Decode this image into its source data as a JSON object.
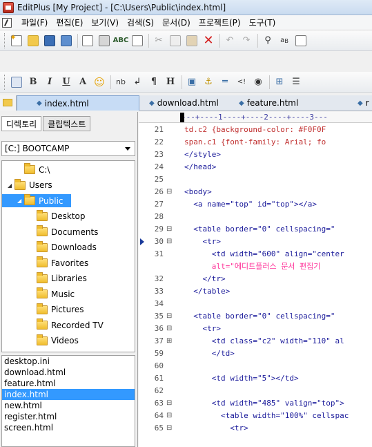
{
  "window": {
    "title": "EditPlus [My Project] - [C:\\Users\\Public\\index.html]"
  },
  "menu": [
    "파일(F)",
    "편집(E)",
    "보기(V)",
    "검색(S)",
    "문서(D)",
    "프로젝트(P)",
    "도구(T)"
  ],
  "toolbar1": [
    "new-file-icon",
    "open-icon",
    "save-icon",
    "save-all-icon",
    "print-preview-icon",
    "print-icon",
    "spellcheck-icon",
    "page-icon",
    "cut-icon",
    "copy-icon",
    "paste-icon",
    "delete-icon",
    "undo-icon",
    "redo-icon",
    "find-icon",
    "replace-icon",
    "copy-doc-icon"
  ],
  "toolbar2": {
    "buttons": [
      {
        "name": "html-preview-icon",
        "label": ""
      },
      {
        "name": "bold-button",
        "label": "B"
      },
      {
        "name": "italic-button",
        "label": "I"
      },
      {
        "name": "underline-button",
        "label": "U"
      },
      {
        "name": "font-button",
        "label": "A"
      },
      {
        "name": "color-button",
        "label": "☺"
      },
      {
        "name": "nbsp-button",
        "label": "nb"
      },
      {
        "name": "break-button",
        "label": "↲"
      },
      {
        "name": "paragraph-button",
        "label": "¶"
      },
      {
        "name": "heading-button",
        "label": "H"
      },
      {
        "name": "image-button",
        "label": "▣"
      },
      {
        "name": "anchor-button",
        "label": "⚓"
      },
      {
        "name": "hr-button",
        "label": "═"
      },
      {
        "name": "comment-button",
        "label": "<!"
      },
      {
        "name": "center-button",
        "label": "◉"
      },
      {
        "name": "table-button",
        "label": "⊞"
      },
      {
        "name": "list-button",
        "label": "☰"
      }
    ]
  },
  "tabs": [
    "index.html",
    "download.html",
    "feature.html",
    "r"
  ],
  "left": {
    "subtabs": [
      "디렉토리",
      "클립텍스트"
    ],
    "drive": "[C:] BOOTCAMP",
    "tree": [
      {
        "label": "C:\\",
        "depth": 1,
        "expanded": false,
        "selected": false
      },
      {
        "label": "Users",
        "depth": 1,
        "expanded": true,
        "selected": false
      },
      {
        "label": "Public",
        "depth": 2,
        "expanded": true,
        "selected": true
      },
      {
        "label": "Desktop",
        "depth": 3,
        "expanded": false,
        "selected": false
      },
      {
        "label": "Documents",
        "depth": 3,
        "expanded": false,
        "selected": false
      },
      {
        "label": "Downloads",
        "depth": 3,
        "expanded": false,
        "selected": false
      },
      {
        "label": "Favorites",
        "depth": 3,
        "expanded": false,
        "selected": false
      },
      {
        "label": "Libraries",
        "depth": 3,
        "expanded": false,
        "selected": false
      },
      {
        "label": "Music",
        "depth": 3,
        "expanded": false,
        "selected": false
      },
      {
        "label": "Pictures",
        "depth": 3,
        "expanded": false,
        "selected": false
      },
      {
        "label": "Recorded TV",
        "depth": 3,
        "expanded": false,
        "selected": false
      },
      {
        "label": "Videos",
        "depth": 3,
        "expanded": false,
        "selected": false
      }
    ],
    "files": [
      "desktop.ini",
      "download.html",
      "feature.html",
      "index.html",
      "new.html",
      "register.html",
      "screen.html"
    ],
    "selected_file": "index.html"
  },
  "editor": {
    "ruler": "---+----1----+----2----+----3---",
    "lines": [
      {
        "n": "21",
        "fold": "",
        "text": "td.c2 {background-color: #F0F0F",
        "cls": "code-red"
      },
      {
        "n": "22",
        "fold": "",
        "text": "span.c1 {font-family: Arial; fo",
        "cls": "code-red"
      },
      {
        "n": "23",
        "fold": "",
        "text": "</style>",
        "cls": "code-text"
      },
      {
        "n": "24",
        "fold": "",
        "text": "</head>",
        "cls": "code-text"
      },
      {
        "n": "25",
        "fold": "",
        "text": "",
        "cls": "code-text"
      },
      {
        "n": "26",
        "fold": "⊟",
        "text": "<body>",
        "cls": "code-text"
      },
      {
        "n": "27",
        "fold": "",
        "text": "  <a name=\"top\" id=\"top\"></a>",
        "cls": "code-text"
      },
      {
        "n": "28",
        "fold": "",
        "text": "",
        "cls": "code-text"
      },
      {
        "n": "29",
        "fold": "⊟",
        "text": "  <table border=\"0\" cellspacing=\"",
        "cls": "code-text"
      },
      {
        "n": "30",
        "fold": "⊟",
        "text": "    <tr>",
        "cls": "code-text",
        "current": true
      },
      {
        "n": "31",
        "fold": "",
        "text": "      <td width=\"600\" align=\"center",
        "cls": "code-text"
      },
      {
        "n": "",
        "fold": "",
        "text": "      alt=\"에디트플러스 문서 편집기",
        "cls": "code-pink"
      },
      {
        "n": "32",
        "fold": "",
        "text": "    </tr>",
        "cls": "code-text"
      },
      {
        "n": "33",
        "fold": "",
        "text": "  </table>",
        "cls": "code-text"
      },
      {
        "n": "34",
        "fold": "",
        "text": "",
        "cls": "code-text"
      },
      {
        "n": "35",
        "fold": "⊟",
        "text": "  <table border=\"0\" cellspacing=\"",
        "cls": "code-text"
      },
      {
        "n": "36",
        "fold": "⊟",
        "text": "    <tr>",
        "cls": "code-text"
      },
      {
        "n": "37",
        "fold": "⊞",
        "text": "      <td class=\"c2\" width=\"110\" al",
        "cls": "code-text"
      },
      {
        "n": "59",
        "fold": "",
        "text": "      </td>",
        "cls": "code-text"
      },
      {
        "n": "60",
        "fold": "",
        "text": "",
        "cls": "code-text"
      },
      {
        "n": "61",
        "fold": "",
        "text": "      <td width=\"5\"></td>",
        "cls": "code-text"
      },
      {
        "n": "62",
        "fold": "",
        "text": "",
        "cls": "code-text"
      },
      {
        "n": "63",
        "fold": "⊟",
        "text": "      <td width=\"485\" valign=\"top\">",
        "cls": "code-text"
      },
      {
        "n": "64",
        "fold": "⊟",
        "text": "        <table width=\"100%\" cellspac",
        "cls": "code-text"
      },
      {
        "n": "65",
        "fold": "⊟",
        "text": "          <tr>",
        "cls": "code-text"
      }
    ]
  }
}
